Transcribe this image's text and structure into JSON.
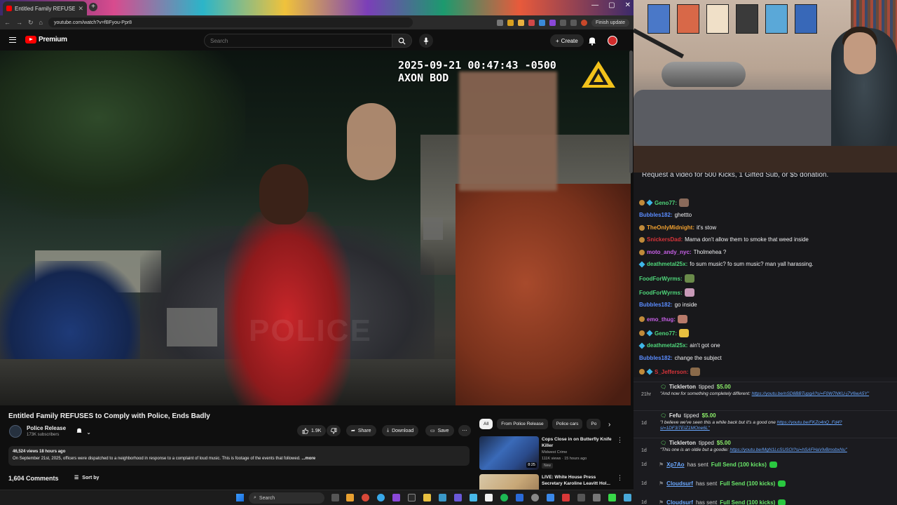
{
  "browser": {
    "tab_title": "Entitled Family REFUSES to",
    "new_tab": "+",
    "window_controls": [
      "—",
      "▢",
      "✕"
    ],
    "url": "youtube.com/watch?v=fBFyou-Ppr8",
    "finish_update": "Finish update"
  },
  "youtube": {
    "brand": "Premium",
    "search_placeholder": "Search",
    "create_label": "Create"
  },
  "video": {
    "timestamp": "2025-09-21 00:47:43 -0500",
    "device": "AXON BOD",
    "watermark": "POLICE"
  },
  "details": {
    "title": "Entitled Family REFUSES to Comply with Police, Ends Badly",
    "channel": "Police Release",
    "subscribers": "173K subscribers",
    "likes": "1.9K",
    "share": "Share",
    "download": "Download",
    "save": "Save",
    "description_meta": "46,524 views  18 hours ago",
    "description": "On September 21st, 2025, officers were dispatched to a neighborhood in response to a complaint of loud music. This is footage of the events that followed.",
    "more": "...more",
    "comments_count": "1,604 Comments",
    "sort_by": "Sort by"
  },
  "chips": [
    "All",
    "From Police Release",
    "Police cars",
    "Po"
  ],
  "recommendations": [
    {
      "title": "Cops Close in on Butterfly Knife Killer",
      "channel": "Midwest Crime",
      "views": "111K views · 15 hours ago",
      "badge": "New",
      "duration": "8:25",
      "color": "#3a6ab8"
    },
    {
      "title": "LIVE: White House Press Secretary Karoline Leavitt Hol...",
      "channel": "",
      "views": "",
      "badge": "",
      "duration": "",
      "color": "#c8a878"
    }
  ],
  "chat": {
    "banner": "Request a video for 500 Kicks, 1 Gifted Sub, or $5 donation.",
    "messages": [
      {
        "user": "Geno77:",
        "color": "#4fd67a",
        "text": "",
        "emote": "#8a6a5a",
        "badge": "both"
      },
      {
        "user": "Bubbles182:",
        "color": "#5a8cff",
        "text": "ghettto",
        "emote": "",
        "badge": "none"
      },
      {
        "user": "TheOnlyMidnight:",
        "color": "#f0a030",
        "text": "it's stow",
        "emote": "",
        "badge": "sm"
      },
      {
        "user": "SnickersDad:",
        "color": "#d8343a",
        "text": "Mama don't allow them to smoke that weed inside",
        "emote": "",
        "badge": "sm"
      },
      {
        "user": "moto_andy_nyc:",
        "color": "#c860e8",
        "text": "Tholmehea ?",
        "emote": "",
        "badge": "sm"
      },
      {
        "user": "deathmetal25x:",
        "color": "#4fd67a",
        "text": "fo sum music? fo sum music? man yall harassing.",
        "emote": "",
        "badge": "gem"
      },
      {
        "user": "FoodForWyrms:",
        "color": "#4fd67a",
        "text": "",
        "emote": "#6a8a4a",
        "badge": "none"
      },
      {
        "user": "FoodForWyrms:",
        "color": "#4fd67a",
        "text": "",
        "emote": "#c89ab8",
        "badge": "none"
      },
      {
        "user": "Bubbles182:",
        "color": "#5a8cff",
        "text": "go inside",
        "emote": "",
        "badge": "none"
      },
      {
        "user": "emo_thug:",
        "color": "#c860e8",
        "text": "",
        "emote": "#b87a6a",
        "badge": "sm"
      },
      {
        "user": "Geno77:",
        "color": "#4fd67a",
        "text": "",
        "emote": "#e8c040",
        "badge": "both"
      },
      {
        "user": "deathmetal25x:",
        "color": "#4fd67a",
        "text": "ain't got one",
        "emote": "",
        "badge": "gem"
      },
      {
        "user": "Bubbles182:",
        "color": "#5a8cff",
        "text": "change the subject",
        "emote": "",
        "badge": "none"
      },
      {
        "user": "S_Jefferson:",
        "color": "#d8343a",
        "text": "",
        "emote": "#8a6a4a",
        "badge": "both"
      }
    ]
  },
  "donations": [
    {
      "time": "21hr",
      "name": "Ticklerton",
      "verb": "tipped",
      "amount": "$5.00",
      "msg": "\"And now for something completely different:",
      "link": "https://youtu.be/nSD8BBTupgA?si=F0W7NKU-j7V6wA5Y\""
    },
    {
      "time": "1d",
      "name": "Fefu",
      "verb": "tipped",
      "amount": "$5.00",
      "msg": "\"I believe we've seen this a while back but it's a good one",
      "link": "https://youtu.be/FKZo4nQ_Fd4?si=1DF3iTEIZ1MOne6L\""
    },
    {
      "time": "1d",
      "name": "Ticklerton",
      "verb": "tipped",
      "amount": "$5.00",
      "msg": "\"This one is an oldie but a goodie:",
      "link": "https://youtu.be/MgN1LcSUSOI?si=hSAFHaVlvBmobxNu\""
    }
  ],
  "kicks": [
    {
      "time": "1d",
      "user": "Xp7Ao",
      "action": "has sent",
      "item": "Full Send (100 kicks)"
    },
    {
      "time": "1d",
      "user": "Cloudsurf",
      "action": "has sent",
      "item": "Full Send (100 kicks)"
    },
    {
      "time": "1d",
      "user": "Cloudsurf",
      "action": "has sent",
      "item": "Full Send (100 kicks)"
    }
  ],
  "taskbar": {
    "search": "Search"
  }
}
